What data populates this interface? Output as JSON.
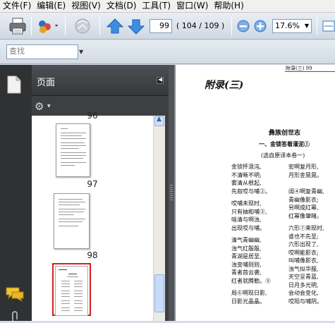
{
  "menu": [
    "文件(F)",
    "编辑(E)",
    "视图(V)",
    "文档(D)",
    "工具(T)",
    "窗口(W)",
    "帮助(H)"
  ],
  "toolbar": {
    "page_current": "99",
    "page_status": "( 104 / 109 )",
    "zoom": "17.6%"
  },
  "find": {
    "placeholder": "查找"
  },
  "panel": {
    "title": "页面",
    "thumbnails": [
      {
        "label": "96"
      },
      {
        "label": "97"
      },
      {
        "label": "98"
      }
    ]
  },
  "document": {
    "running_header": "附录(三)    99",
    "appendix_title": "附录(三)",
    "poem_title": "彝族创世志",
    "section_title": "一、金锁答着灌泥①",
    "subtitle": "(选自原译本卷一)",
    "left_col": [
      "金锁怀混沌,",
      "不清晰不明;",
      "雾清从根起,",
      "先叙哎与哺②。",
      "",
      "哎哺未现时,",
      "只有抽和哺③,",
      "啥清与啊浊,",
      "出现哎与哺。",
      "",
      "清气青幽幽,",
      "浊气红殷殷,",
      "青湖是居至,",
      "浊变哺则则,",
      "青者首云袭,",
      "红者就腾勒。⑤",
      "",
      "局⑥啊现日影,",
      "日影光晶晶。"
    ],
    "right_col": [
      "宏啊复月形,",
      "月形金晃晃。",
      "",
      "",
      "阔④啊复青幽,",
      "青幽像影衣;",
      "另啊成红幂,",
      "红幂像肇睹。",
      "",
      "六形⑦来现时,",
      "谁也不先至;",
      "六形出现了,",
      "哎啊能影衣;",
      "叫哺像影衣,",
      "浊气似华服,",
      "天空呈青蓝,",
      "日月多光明,",
      "会动会变化,",
      "哎阳与哺阴。"
    ]
  }
}
